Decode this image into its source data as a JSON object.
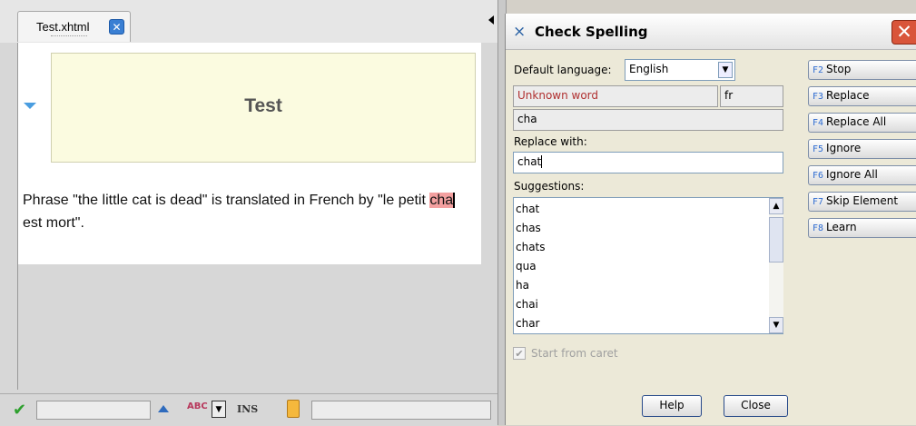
{
  "editor": {
    "tab_label": "Test.xhtml",
    "tab_close_glyph": "✕",
    "doc_title": "Test",
    "paragraph_before": "Phrase \"the little cat is dead\" is translated in French by \"le petit ",
    "highlighted_word": "cha",
    "paragraph_after": " est mort\".",
    "status_ins": "INS"
  },
  "dialog": {
    "title": "Check Spelling",
    "close_glyph": "✕",
    "default_language_label": "Default language:",
    "default_language_value": "English",
    "unknown_word_label": "Unknown word",
    "unknown_word_lang": "fr",
    "unknown_word_value": "cha",
    "replace_with_label": "Replace with:",
    "replace_with_value": "chat",
    "suggestions_label": "Suggestions:",
    "suggestions": [
      "chat",
      "chas",
      "chats",
      "qua",
      "ha",
      "chai",
      "char"
    ],
    "start_from_caret": "Start from caret",
    "buttons": [
      {
        "key": "F2",
        "label": "Stop"
      },
      {
        "key": "F3",
        "label": "Replace"
      },
      {
        "key": "F4",
        "label": "Replace All"
      },
      {
        "key": "F5",
        "label": "Ignore"
      },
      {
        "key": "F6",
        "label": "Ignore All"
      },
      {
        "key": "F7",
        "label": "Skip Element"
      },
      {
        "key": "F8",
        "label": "Learn"
      }
    ],
    "help_label": "Help",
    "close_label": "Close"
  },
  "colors": {
    "unknown_word": "#b03030",
    "highlight": "#f4a0a0",
    "key_hint": "#2d6bd1"
  }
}
